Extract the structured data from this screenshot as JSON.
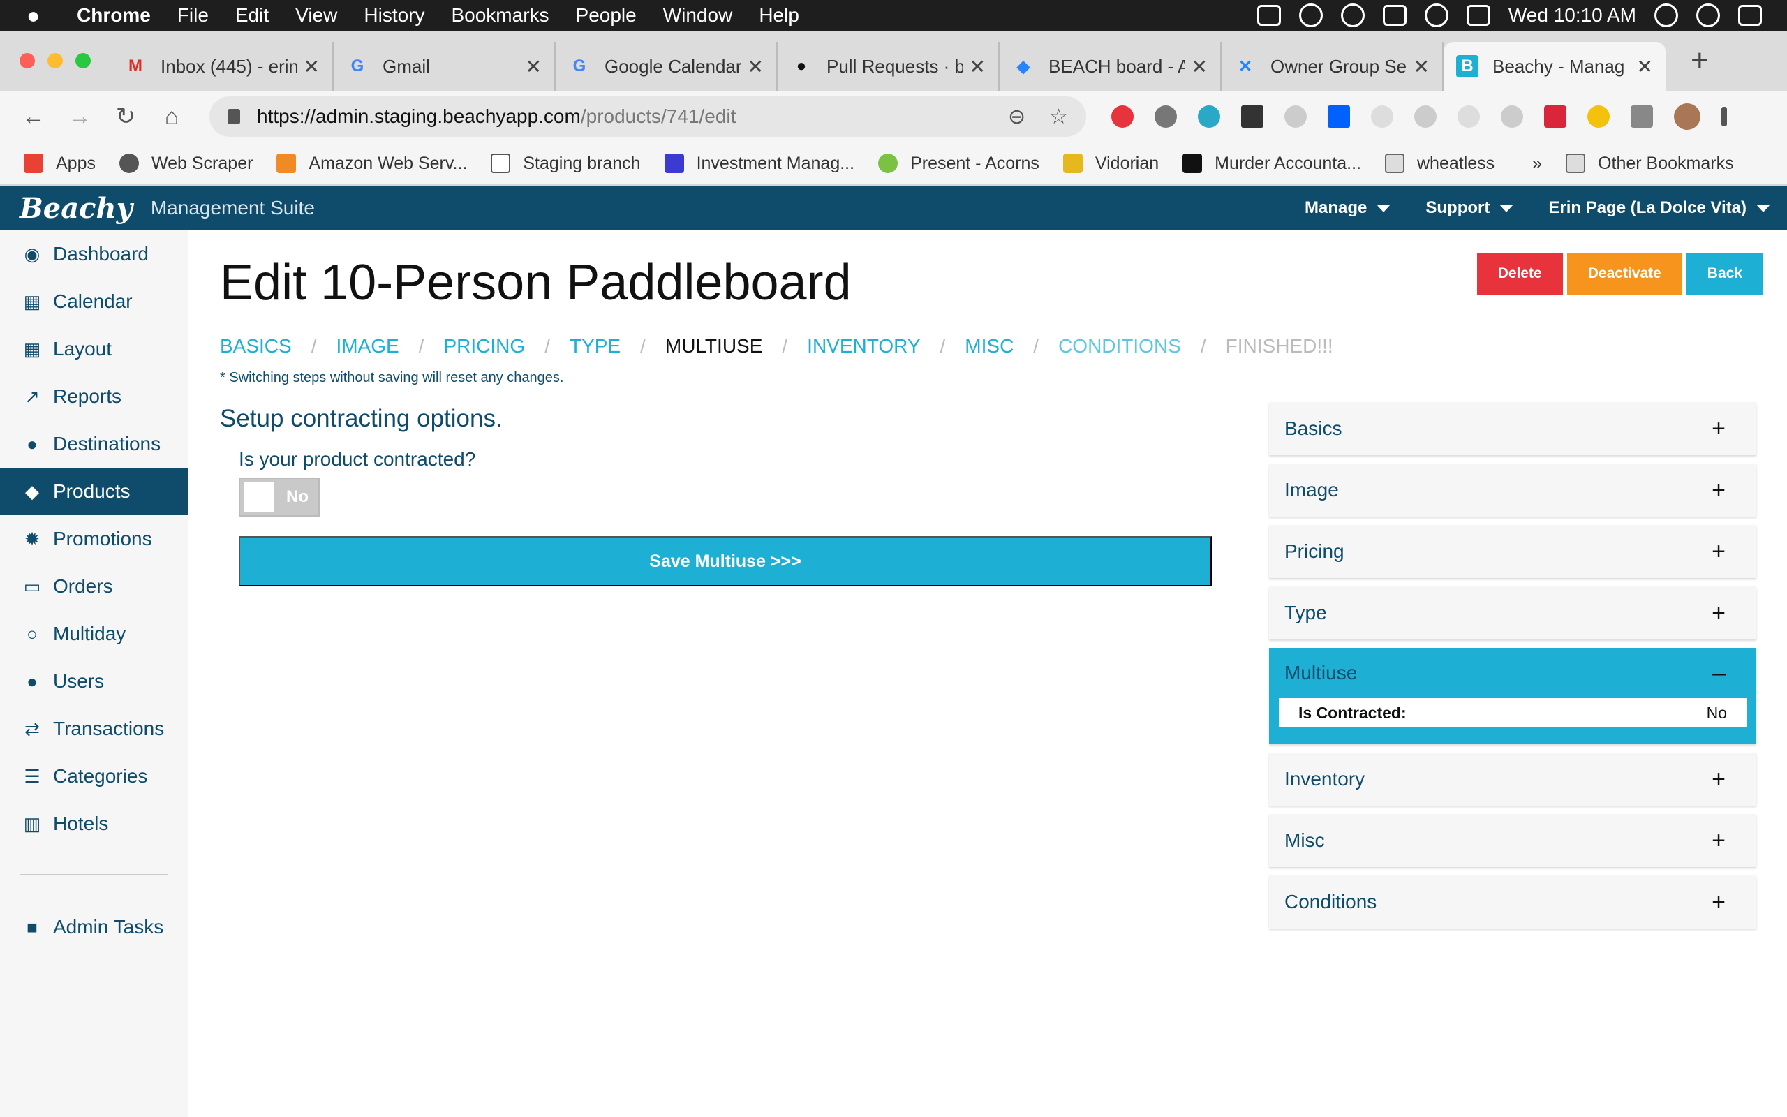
{
  "os_menubar": {
    "app": "Chrome",
    "items": [
      "File",
      "Edit",
      "View",
      "History",
      "Bookmarks",
      "People",
      "Window",
      "Help"
    ],
    "clock": "Wed 10:10 AM"
  },
  "browser": {
    "tabs": [
      {
        "title": "Inbox (445) - erin",
        "icon": "gmail-icon",
        "color": "#d93025"
      },
      {
        "title": "Gmail",
        "icon": "google-icon",
        "color": "#4285f4"
      },
      {
        "title": "Google Calendar",
        "icon": "google-icon",
        "color": "#4285f4"
      },
      {
        "title": "Pull Requests · b",
        "icon": "github-icon",
        "color": "#111111"
      },
      {
        "title": "BEACH board - A",
        "icon": "jira-icon",
        "color": "#2684ff"
      },
      {
        "title": "Owner Group Se",
        "icon": "confluence-icon",
        "color": "#2684ff"
      },
      {
        "title": "Beachy - Manag",
        "icon": "beachy-icon",
        "color": "#1eafd4"
      }
    ],
    "url_host": "https://admin.staging.beachyapp.com",
    "url_path": "/products/741/edit",
    "bookmarks": [
      {
        "label": "Apps",
        "color": "#e94235"
      },
      {
        "label": "Web Scraper",
        "color": "#555555"
      },
      {
        "label": "Amazon Web Serv...",
        "color": "#f08a24"
      },
      {
        "label": "Staging branch",
        "color": "#ffffff"
      },
      {
        "label": "Investment Manag...",
        "color": "#3b3bd1"
      },
      {
        "label": "Present - Acorns",
        "color": "#7cc242"
      },
      {
        "label": "Vidorian",
        "color": "#e5b91e"
      },
      {
        "label": "Murder Accounta...",
        "color": "#111111"
      },
      {
        "label": "wheatless",
        "color": "#dddddd"
      }
    ],
    "more_bookmarks": "»",
    "other_bookmarks": "Other Bookmarks"
  },
  "app": {
    "logo": "Beachy",
    "suite": "Management Suite",
    "nav": [
      "Manage",
      "Support",
      "Erin Page (La Dolce Vita)"
    ]
  },
  "sidebar": {
    "items": [
      {
        "label": "Dashboard",
        "icon": "dashboard-icon",
        "glyph": "◉"
      },
      {
        "label": "Calendar",
        "icon": "calendar-icon",
        "glyph": "▦"
      },
      {
        "label": "Layout",
        "icon": "grid-icon",
        "glyph": "▦"
      },
      {
        "label": "Reports",
        "icon": "line-chart-icon",
        "glyph": "↗"
      },
      {
        "label": "Destinations",
        "icon": "map-pin-icon",
        "glyph": "●"
      },
      {
        "label": "Products",
        "icon": "tag-icon",
        "glyph": "◆"
      },
      {
        "label": "Promotions",
        "icon": "badge-icon",
        "glyph": "✹"
      },
      {
        "label": "Orders",
        "icon": "credit-card-icon",
        "glyph": "▭"
      },
      {
        "label": "Multiday",
        "icon": "search-icon",
        "glyph": "○"
      },
      {
        "label": "Users",
        "icon": "user-icon",
        "glyph": "●"
      },
      {
        "label": "Transactions",
        "icon": "exchange-icon",
        "glyph": "⇄"
      },
      {
        "label": "Categories",
        "icon": "list-icon",
        "glyph": "☰"
      },
      {
        "label": "Hotels",
        "icon": "building-icon",
        "glyph": "▥"
      }
    ],
    "active": "Products",
    "admin": {
      "label": "Admin Tasks",
      "icon": "lock-icon",
      "glyph": "■"
    }
  },
  "page": {
    "title": "Edit 10-Person Paddleboard",
    "actions": [
      {
        "label": "Delete",
        "color": "#e8323c"
      },
      {
        "label": "Deactivate",
        "color": "#f7941d"
      },
      {
        "label": "Back",
        "color": "#1eafd4"
      }
    ],
    "steps": [
      {
        "label": "BASICS",
        "state": "link"
      },
      {
        "label": "IMAGE",
        "state": "link"
      },
      {
        "label": "PRICING",
        "state": "link"
      },
      {
        "label": "TYPE",
        "state": "link"
      },
      {
        "label": "MULTIUSE",
        "state": "current"
      },
      {
        "label": "INVENTORY",
        "state": "link"
      },
      {
        "label": "MISC",
        "state": "link"
      },
      {
        "label": "CONDITIONS",
        "state": "done"
      },
      {
        "label": "FINISHED!!!",
        "state": "disabled"
      }
    ],
    "note": "* Switching steps without saving will reset any changes.",
    "lead": "Setup contracting options.",
    "question": "Is your product contracted?",
    "toggle_value": "No",
    "save_label": "Save Multiuse >>>"
  },
  "accordion": {
    "panels": [
      "Basics",
      "Image",
      "Pricing",
      "Type"
    ],
    "open_panel": "Multiuse",
    "open_field_key": "Is Contracted:",
    "open_field_value": "No",
    "panels_after": [
      "Inventory",
      "Misc",
      "Conditions"
    ]
  },
  "colors": {
    "brand_navy": "#0f4c6b",
    "accent_blue": "#1eafd4"
  }
}
